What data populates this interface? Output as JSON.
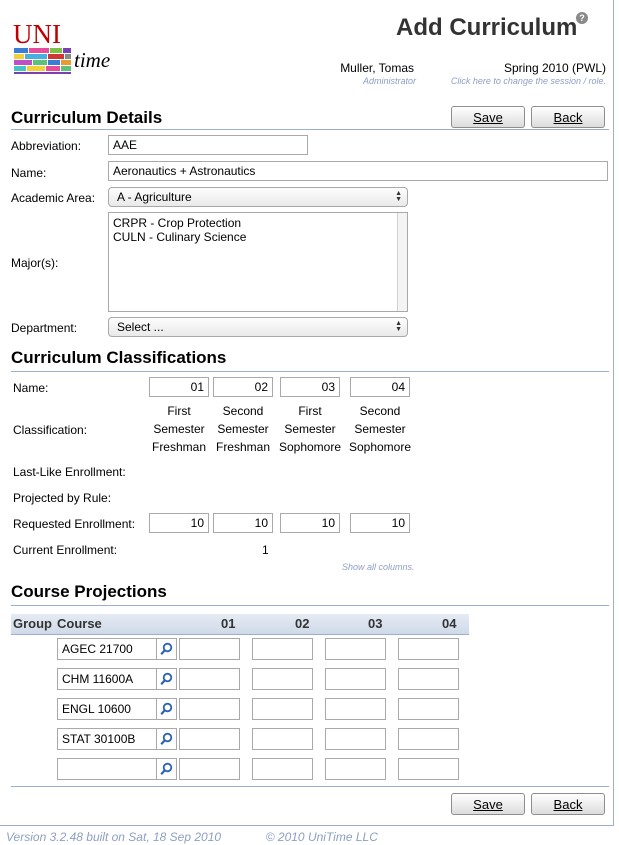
{
  "app": {
    "logo_uni": "UNI",
    "logo_time": "time"
  },
  "header": {
    "title": "Add Curriculum",
    "user_name": "Muller, Tomas",
    "user_role": "Administrator",
    "session_name": "Spring 2010 (PWL)",
    "session_hint": "Click here to change the session / role."
  },
  "buttons": {
    "save": "Save",
    "back": "Back"
  },
  "details": {
    "heading": "Curriculum Details",
    "abbreviation_label": "Abbreviation:",
    "abbreviation_value": "AAE",
    "name_label": "Name:",
    "name_value": "Aeronautics + Astronautics",
    "area_label": "Academic Area:",
    "area_value": "A - Agriculture",
    "majors_label": "Major(s):",
    "majors": [
      "CRPR - Crop Protection",
      "CULN - Culinary Science"
    ],
    "department_label": "Department:",
    "department_value": "Select ..."
  },
  "classifications": {
    "heading": "Curriculum Classifications",
    "name_label": "Name:",
    "classification_label": "Classification:",
    "lastlike_label": "Last-Like Enrollment:",
    "projected_label": "Projected by Rule:",
    "requested_label": "Requested Enrollment:",
    "current_label": "Current Enrollment:",
    "columns": [
      {
        "name": "01",
        "line1": "First",
        "line2": "Semester",
        "line3": "Freshman",
        "requested": "10",
        "current": "1"
      },
      {
        "name": "02",
        "line1": "Second",
        "line2": "Semester",
        "line3": "Freshman",
        "requested": "10",
        "current": ""
      },
      {
        "name": "03",
        "line1": "First",
        "line2": "Semester",
        "line3": "Sophomore",
        "requested": "10",
        "current": ""
      },
      {
        "name": "04",
        "line1": "Second",
        "line2": "Semester",
        "line3": "Sophomore",
        "requested": "10",
        "current": ""
      }
    ],
    "show_all": "Show all columns."
  },
  "projections": {
    "heading": "Course Projections",
    "group_header": "Group",
    "course_header": "Course",
    "col_headers": [
      "01",
      "02",
      "03",
      "04"
    ],
    "courses": [
      "AGEC 21700",
      "CHM 11600A",
      "ENGL 10600",
      "STAT 30100B",
      ""
    ]
  },
  "footer": {
    "version": "Version 3.2.48 built on Sat, 18 Sep 2010",
    "copyright": "© 2010 UniTime LLC"
  },
  "colors": {
    "accent_rule": "#9cb0ce",
    "hint_text": "#8d9fc3",
    "logo_red": "#c00000"
  }
}
